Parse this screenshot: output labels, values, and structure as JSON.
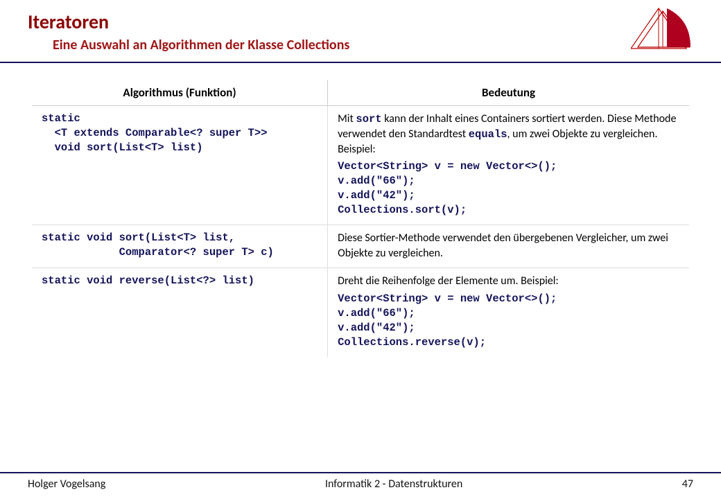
{
  "header": {
    "title": "Iteratoren",
    "subtitle": "Eine Auswahl an Algorithmen der Klasse Collections"
  },
  "table": {
    "col1": "Algorithmus (Funktion)",
    "col2": "Bedeutung",
    "rows": [
      {
        "func": "static\n  <T extends Comparable<? super T>>\n  void sort(List<T> list)",
        "desc_pre": "Mit ",
        "desc_kw1": "sort",
        "desc_mid": " kann der Inhalt eines Containers sortiert werden. Diese Methode verwendet den Standardtest ",
        "desc_kw2": "equals",
        "desc_post": ", um zwei Objekte zu vergleichen. Beispiel:",
        "example": "Vector<String> v = new Vector<>();\nv.add(\"66\");\nv.add(\"42\");\nCollections.sort(v);"
      },
      {
        "func": "static void sort(List<T> list,\n            Comparator<? super T> c)",
        "desc_plain": "Diese Sortier-Methode verwendet den übergebenen Vergleicher, um zwei Objekte zu vergleichen."
      },
      {
        "func": "static void reverse(List<?> list)",
        "desc_plain": "Dreht die Reihenfolge der Elemente um. Beispiel:",
        "example": "Vector<String> v = new Vector<>();\nv.add(\"66\");\nv.add(\"42\");\nCollections.reverse(v);"
      }
    ]
  },
  "footer": {
    "author": "Holger Vogelsang",
    "course": "Informatik 2 - Datenstrukturen",
    "page": "47"
  }
}
